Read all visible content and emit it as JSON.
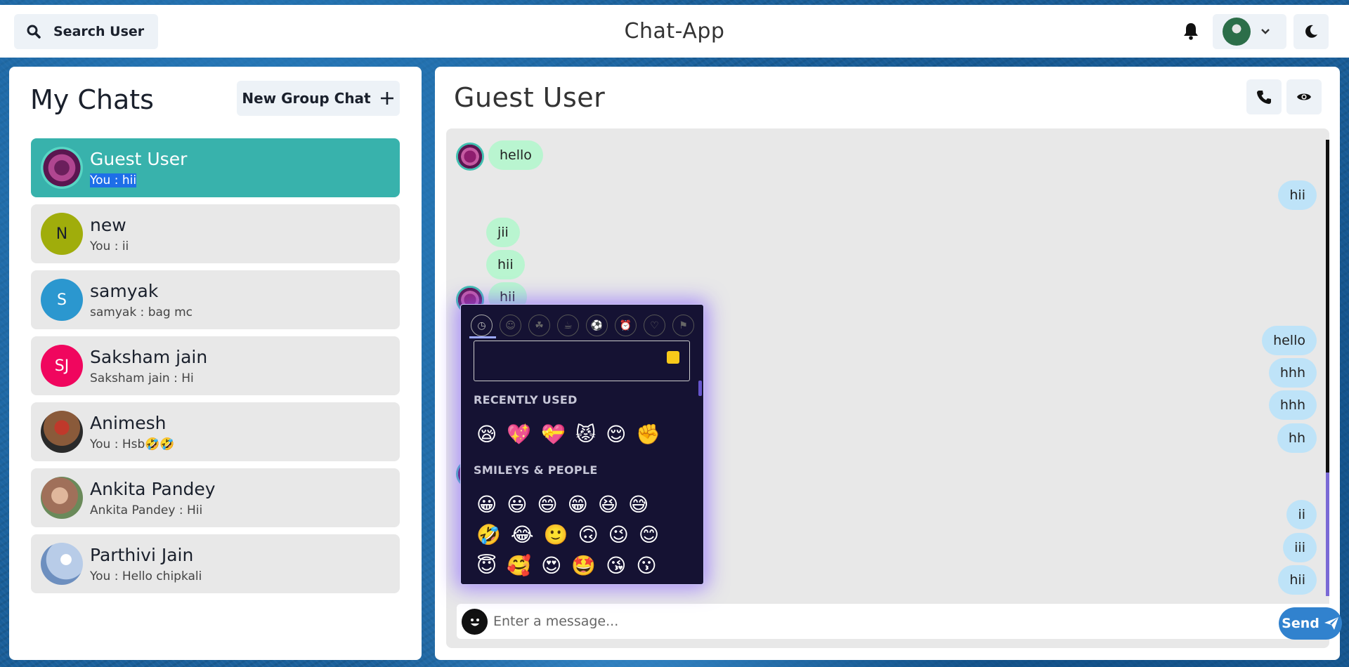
{
  "app": {
    "title": "Chat-App"
  },
  "header": {
    "search_label": "Search User"
  },
  "sidebar": {
    "title": "My Chats",
    "new_group_label": "New Group Chat",
    "chats": [
      {
        "name": "Guest User",
        "last": "You : hii",
        "initials": "",
        "color": "#38b2ac",
        "active": true
      },
      {
        "name": "new",
        "last": "You : ii",
        "initials": "N",
        "color": "#a0ad0b"
      },
      {
        "name": "samyak",
        "last": "samyak : bag mc",
        "initials": "S",
        "color": "#2b97cf"
      },
      {
        "name": "Saksham jain",
        "last": "Saksham jain : Hi",
        "initials": "SJ",
        "color": "#f0065e"
      },
      {
        "name": "Animesh",
        "last": "You : Hsb🤣🤣",
        "initials": "",
        "color": "#6b3a2a"
      },
      {
        "name": "Ankita Pandey",
        "last": "Ankita Pandey : Hii",
        "initials": "",
        "color": "#b88a70"
      },
      {
        "name": "Parthivi Jain",
        "last": "You : Hello chipkali",
        "initials": "",
        "color": "#9bb5d8"
      }
    ]
  },
  "conversation": {
    "title": "Guest User",
    "messages": [
      {
        "text": "hello",
        "dir": "in"
      },
      {
        "text": "hii",
        "dir": "out"
      },
      {
        "text": "jii",
        "dir": "in"
      },
      {
        "text": "hii",
        "dir": "in"
      },
      {
        "text": "hii",
        "dir": "in"
      },
      {
        "text": "hello",
        "dir": "out"
      },
      {
        "text": "hhh",
        "dir": "out"
      },
      {
        "text": "hhh",
        "dir": "out"
      },
      {
        "text": "hh",
        "dir": "out"
      },
      {
        "text": "ii",
        "dir": "out"
      },
      {
        "text": "iii",
        "dir": "out"
      },
      {
        "text": "hii",
        "dir": "out"
      }
    ],
    "input_placeholder": "Enter a message...",
    "send_label": "Send"
  },
  "emoji_picker": {
    "recently_used_title": "RECENTLY USED",
    "smileys_title": "SMILEYS & PEOPLE",
    "recent": [
      "😪",
      "💖",
      "💝",
      "😾",
      "😌",
      "✊"
    ],
    "smileys_row1": [
      "😀",
      "😃",
      "😄",
      "😁",
      "😆",
      "😅"
    ],
    "smileys_row2": [
      "🤣",
      "😂",
      "🙂",
      "🙃",
      "😉",
      "😊"
    ],
    "smileys_row3": [
      "😇",
      "🥰",
      "😍",
      "🤩",
      "😘",
      "😗"
    ]
  }
}
